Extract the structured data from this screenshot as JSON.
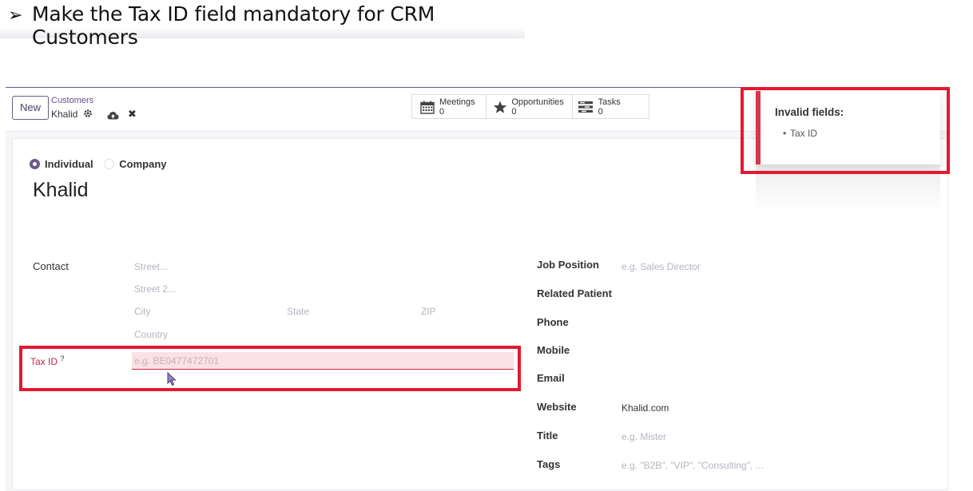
{
  "slide": {
    "bullet": "➢",
    "heading": "Make the Tax ID field mandatory for CRM Customers"
  },
  "control_panel": {
    "new_label": "New",
    "breadcrumb_parent": "Customers",
    "breadcrumb_current": "Khalid",
    "icons": [
      "gear-icon",
      "cloud-upload-icon",
      "close-icon"
    ]
  },
  "smart_buttons": [
    {
      "label": "Meetings",
      "count": "0",
      "icon": "calendar-icon"
    },
    {
      "label": "Opportunities",
      "count": "0",
      "icon": "star-icon"
    },
    {
      "label": "Tasks",
      "count": "0",
      "icon": "tasks-icon"
    }
  ],
  "form": {
    "type_options": [
      "Individual",
      "Company"
    ],
    "type_selected": "Individual",
    "name": "Khalid",
    "contact_label": "Contact",
    "address": {
      "street_ph": "Street...",
      "street2_ph": "Street 2...",
      "city_ph": "City",
      "state_ph": "State",
      "zip_ph": "ZIP",
      "country_ph": "Country"
    },
    "tax_id": {
      "label": "Tax ID",
      "help": "?",
      "placeholder": "e.g. BE0477472701"
    },
    "right": {
      "job_position_label": "Job Position",
      "job_position_ph": "e.g. Sales Director",
      "related_patient_label": "Related Patient",
      "phone_label": "Phone",
      "mobile_label": "Mobile",
      "email_label": "Email",
      "website_label": "Website",
      "website_value": "Khalid.com",
      "title_label": "Title",
      "title_ph": "e.g. Mister",
      "tags_label": "Tags",
      "tags_ph": "e.g. \"B2B\", \"VIP\", \"Consulting\", ..."
    }
  },
  "notification": {
    "title": "Invalid fields:",
    "items": [
      "Tax ID"
    ]
  },
  "colors": {
    "accent": "#6b5a8c",
    "danger": "#d9354e",
    "highlight": "#e3192f",
    "invalid_bg": "#fbe1e6"
  }
}
